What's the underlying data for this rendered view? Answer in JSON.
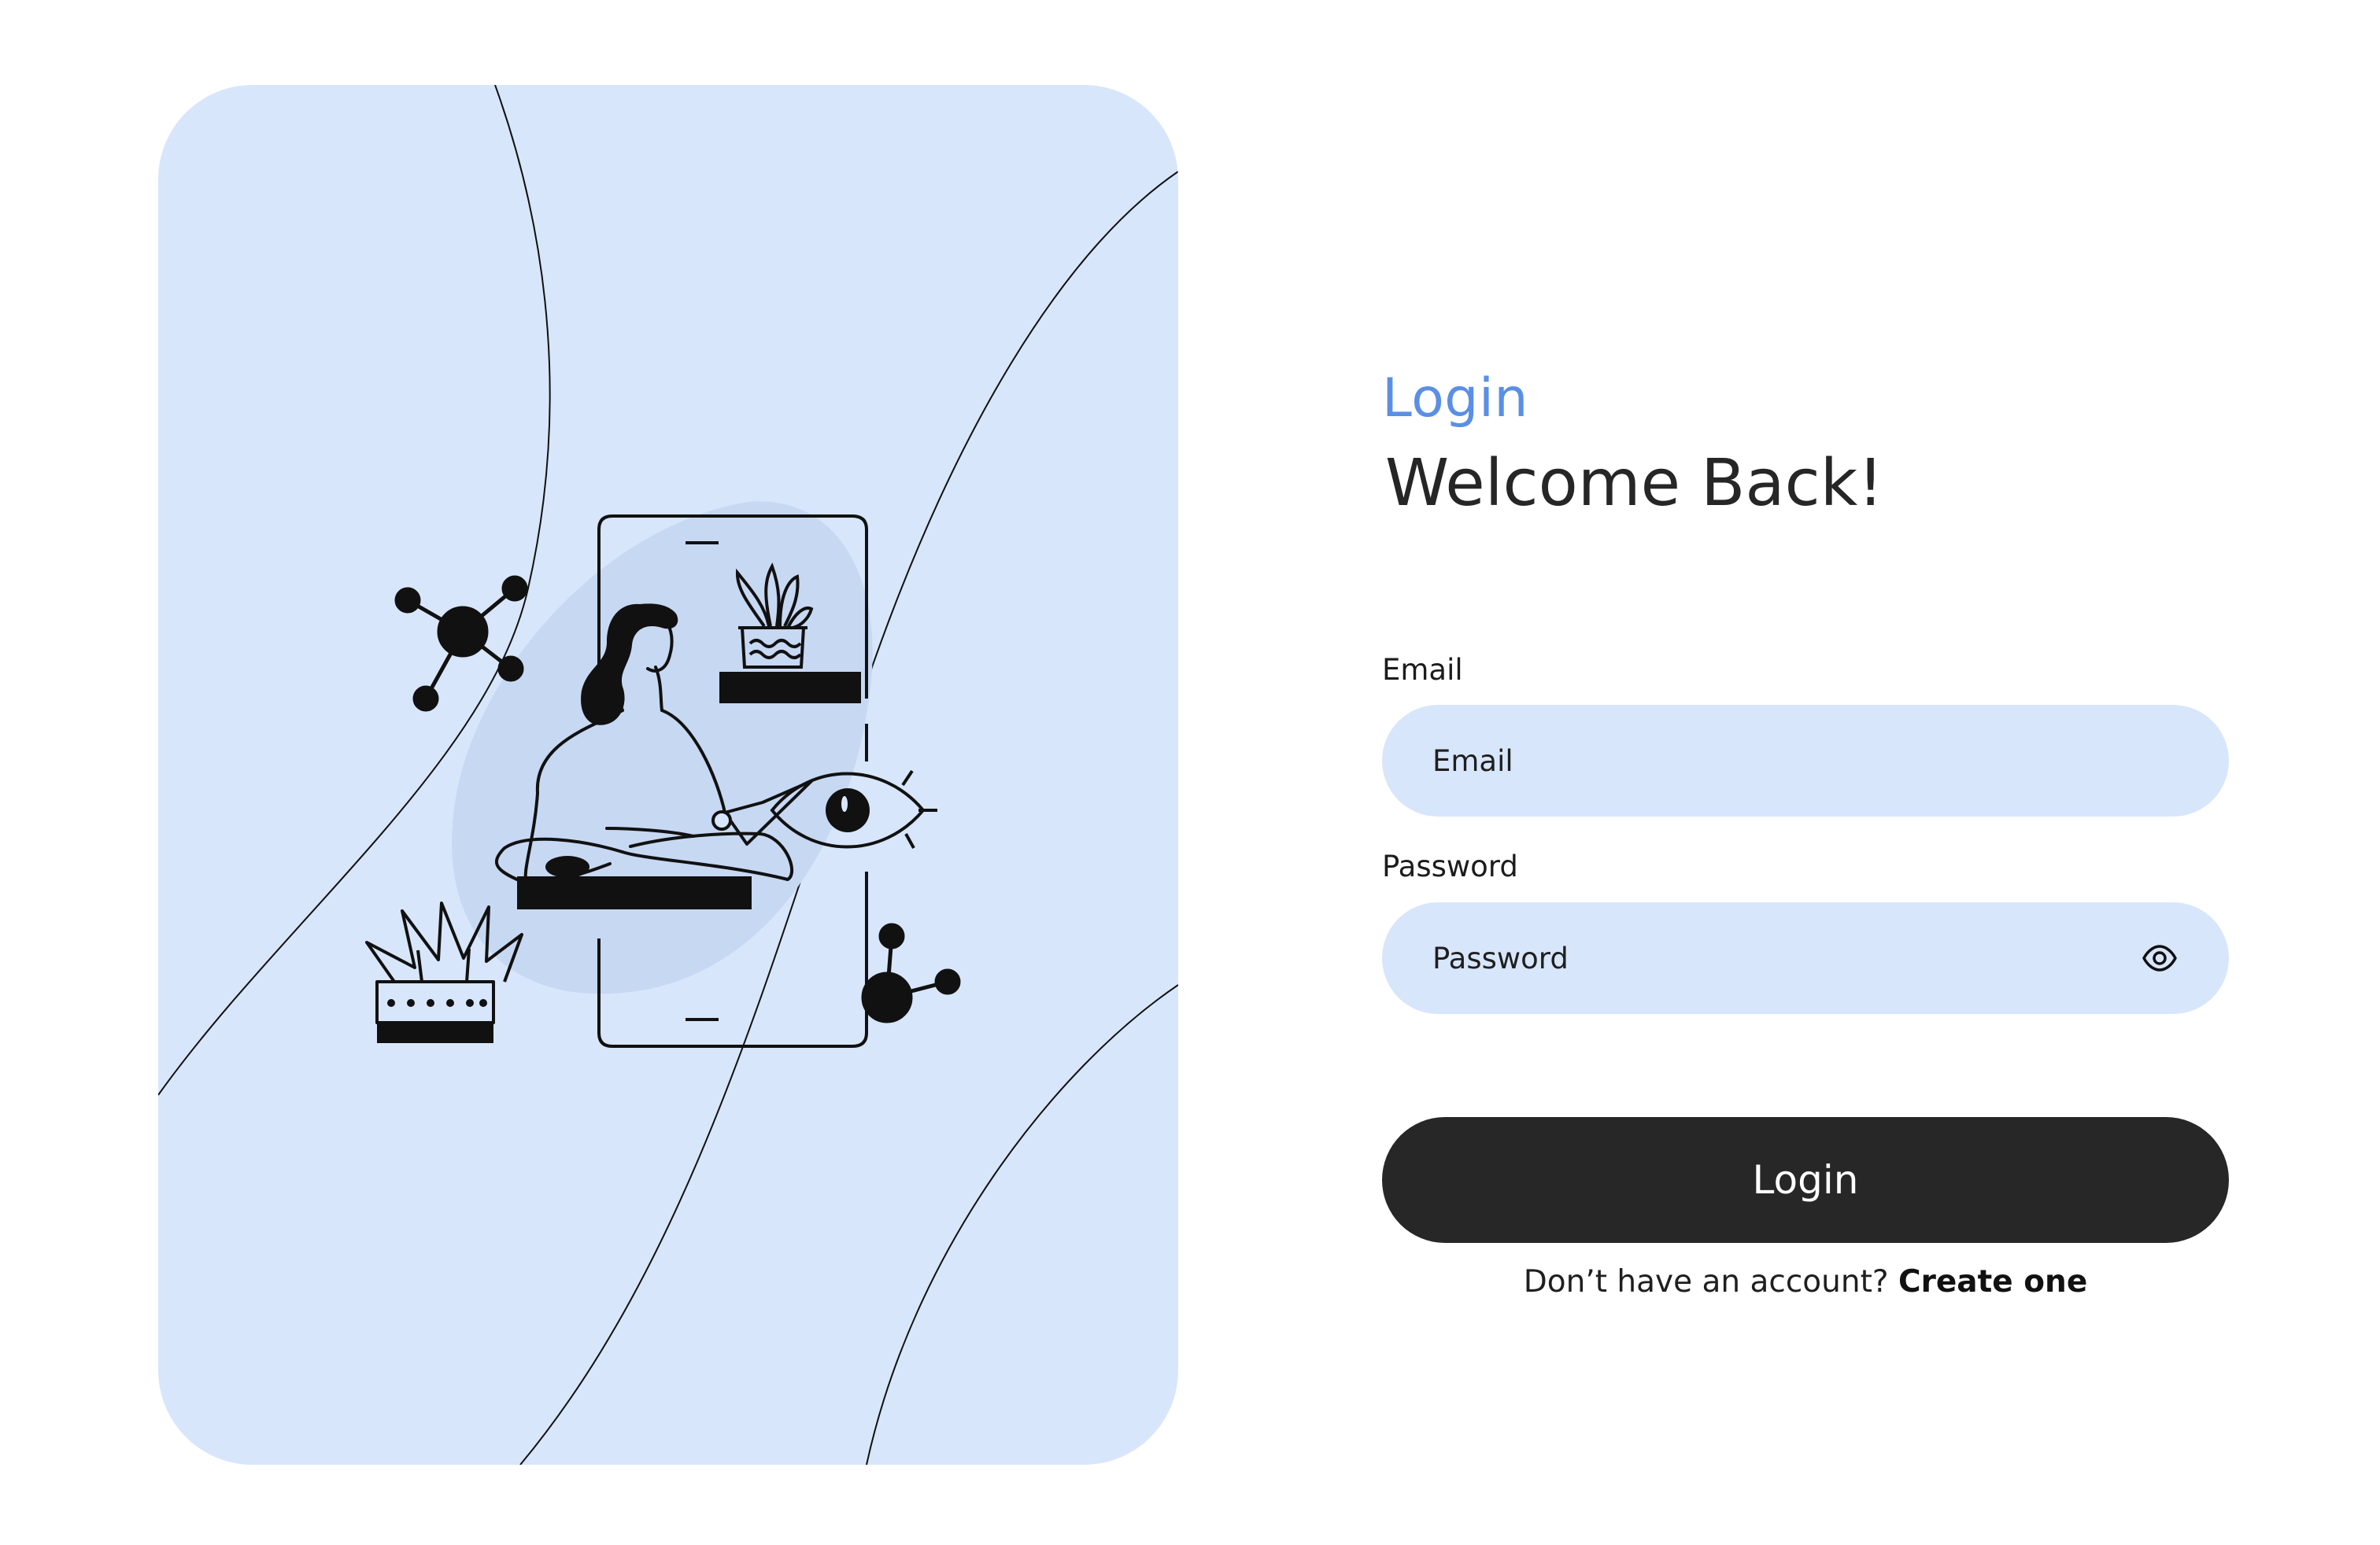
{
  "form": {
    "eyebrow": "Login",
    "heading": "Welcome Back!",
    "email": {
      "label": "Email",
      "placeholder": "Email",
      "value": ""
    },
    "password": {
      "label": "Password",
      "placeholder": "Password",
      "value": "",
      "toggle_icon": "eye-icon"
    },
    "submit_label": "Login",
    "signup_prompt": "Don’t have an account?",
    "signup_link": "Create one"
  },
  "colors": {
    "accent": "#5b8fe6",
    "input_background": "#d8e6fb",
    "button_background": "#272727",
    "text": "#262626"
  }
}
